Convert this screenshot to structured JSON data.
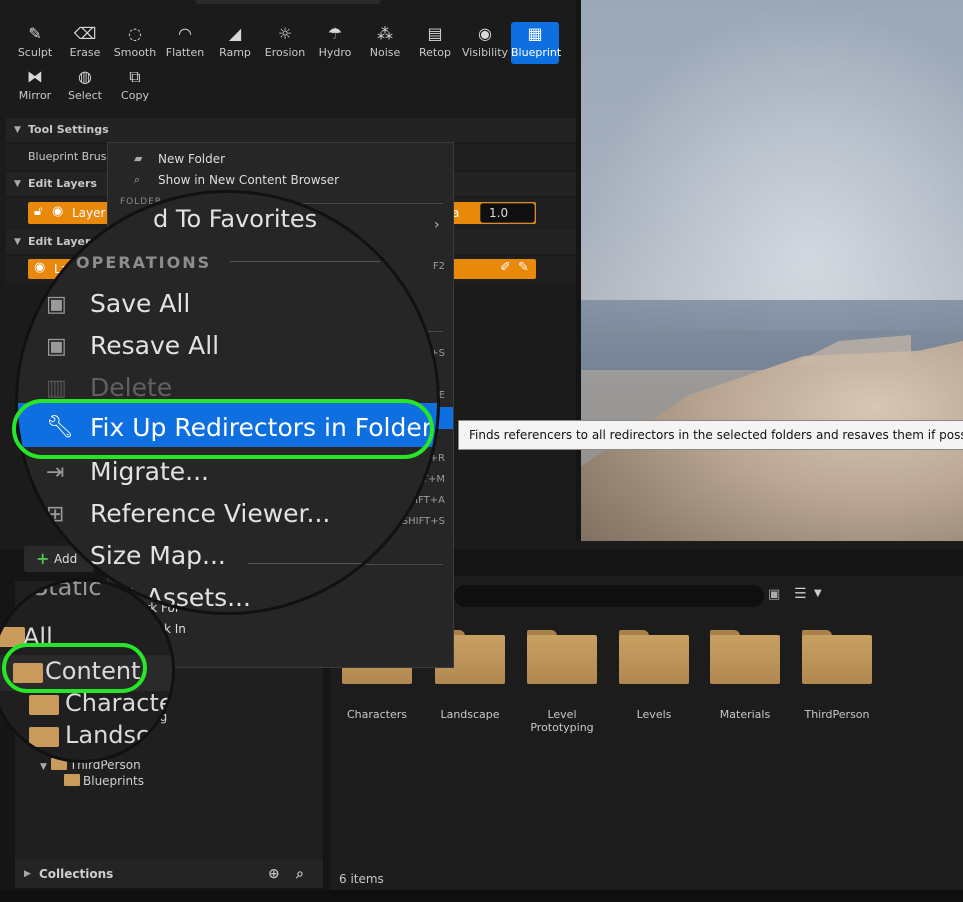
{
  "toolbar": {
    "tools": [
      {
        "label": "Sculpt",
        "icon": "sculpt-brush-icon",
        "glyph": "✎"
      },
      {
        "label": "Erase",
        "icon": "eraser-icon",
        "glyph": "⌫"
      },
      {
        "label": "Smooth",
        "icon": "smooth-icon",
        "glyph": "◌"
      },
      {
        "label": "Flatten",
        "icon": "flatten-icon",
        "glyph": "◠"
      },
      {
        "label": "Ramp",
        "icon": "ramp-icon",
        "glyph": "◢"
      },
      {
        "label": "Erosion",
        "icon": "erosion-icon",
        "glyph": "☼"
      },
      {
        "label": "Hydro",
        "icon": "hydro-icon",
        "glyph": "☂"
      },
      {
        "label": "Noise",
        "icon": "noise-icon",
        "glyph": "⁂"
      },
      {
        "label": "Retop",
        "icon": "retopologize-icon",
        "glyph": "▤"
      },
      {
        "label": "Visibility",
        "icon": "visibility-eye-icon",
        "glyph": "◉"
      },
      {
        "label": "Blueprint",
        "icon": "blueprint-icon",
        "glyph": "▦"
      },
      {
        "label": "Mirror",
        "icon": "mirror-icon",
        "glyph": "⧓"
      },
      {
        "label": "Select",
        "icon": "select-lasso-icon",
        "glyph": "◍"
      },
      {
        "label": "Copy",
        "icon": "copy-icon",
        "glyph": "⧉"
      }
    ],
    "active": "Blueprint"
  },
  "tool_settings": {
    "header": "Tool Settings",
    "blueprint_brush_label": "Blueprint Brush"
  },
  "edit_layers": {
    "header": "Edit Layers",
    "layer_label": "Layer",
    "alpha_suffix": "a",
    "alpha_value": "1.0"
  },
  "edit_layer_blueprints": {
    "header": "Edit Layer Bl",
    "layer_label": "La"
  },
  "context_menu": {
    "items": [
      {
        "label": "New Folder",
        "icon": "new-folder-icon"
      },
      {
        "label": "Show in New Content Browser",
        "icon": "content-browser-icon"
      }
    ],
    "folder_section": "FOLDER",
    "shortcuts": [
      "F2",
      "T+S",
      "E",
      "T+R",
      "T+M",
      "HIFT+A",
      "SHIFT+S"
    ],
    "lower_items": [
      "ark For",
      "k In"
    ]
  },
  "magnifier": {
    "add_to_favorites": "Add To Favorites",
    "operations_header": "OPERATIONS",
    "save_all": "Save All",
    "resave_all": "Resave All",
    "delete": "Delete",
    "fix_up_redirectors": "Fix Up Redirectors in Folder",
    "migrate": "Migrate...",
    "reference_viewer": "Reference Viewer...",
    "size_map": "Size Map...",
    "audit_assets": "Audit Assets...",
    "operations_header_partial": "OPERATIONS",
    "add_to_favorites_partial": "d To Favorites",
    "audit_assets_partial": "t Assets..."
  },
  "tooltip": {
    "text": "Finds referencers to all redirectors in the selected folders and resaves them if possible, then d"
  },
  "content_browser": {
    "add_label": "Add",
    "tree": {
      "thirdperson": "ThirdPerson",
      "blueprints": "Blueprints",
      "partial_ng": "ng"
    },
    "magnifier2": {
      "static": "Static",
      "all": "All",
      "content": "Content",
      "characters": "Characte",
      "landscape": "Landsca"
    },
    "folders": [
      {
        "name": "Characters"
      },
      {
        "name": "Landscape"
      },
      {
        "name": "Level\nPrototyping"
      },
      {
        "name": "Levels"
      },
      {
        "name": "Materials"
      },
      {
        "name": "ThirdPerson"
      }
    ],
    "collections_label": "Collections",
    "item_count": "6 items"
  }
}
